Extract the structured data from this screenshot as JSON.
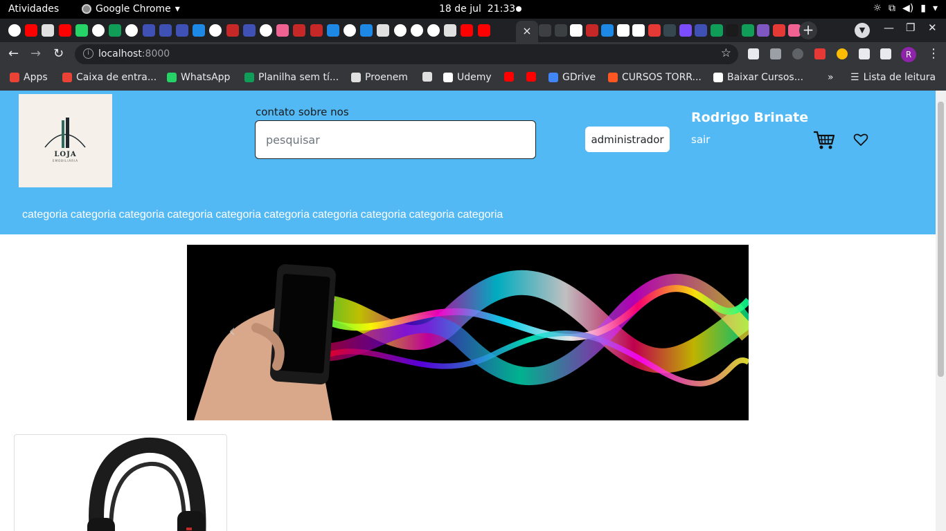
{
  "system": {
    "activities": "Atividades",
    "app_name": "Google Chrome",
    "date": "18 de jul",
    "time": "21:33"
  },
  "browser": {
    "active_tab_close": "×",
    "url_host": "localhost",
    "url_port": ":8000",
    "profile_initial": "R",
    "bookmarks": [
      {
        "label": "Apps",
        "icon": "apps-grid-icon",
        "color": "#ea4335"
      },
      {
        "label": "Caixa de entra...",
        "icon": "gmail-icon",
        "color": "#ea4335"
      },
      {
        "label": "WhatsApp",
        "icon": "whatsapp-icon",
        "color": "#25d366"
      },
      {
        "label": "Planilha sem tí...",
        "icon": "sheets-icon",
        "color": "#0f9d58"
      },
      {
        "label": "Proenem",
        "icon": "proenem-icon",
        "color": "#e0e0e0"
      },
      {
        "label": "",
        "icon": "globe-icon",
        "color": "#e0e0e0"
      },
      {
        "label": "Udemy",
        "icon": "udemy-icon",
        "color": "#ffffff"
      },
      {
        "label": "",
        "icon": "youtube-icon",
        "color": "#ff0000"
      },
      {
        "label": "",
        "icon": "youtube-icon",
        "color": "#ff0000"
      },
      {
        "label": "GDrive",
        "icon": "gdrive-icon",
        "color": "#4285f4"
      },
      {
        "label": "CURSOS TORR...",
        "icon": "blogger-icon",
        "color": "#ff5722"
      },
      {
        "label": "Baixar Cursos...",
        "icon": "drive-icon",
        "color": "#ffffff"
      }
    ],
    "overflow": "»",
    "reading_list": "Lista de leitura"
  },
  "site": {
    "logo_text": "LOJA",
    "logo_subtext": "EMOBILIÁRIA",
    "header_links": "contato sobre nos",
    "search_placeholder": "pesquisar",
    "admin_button": "administrador",
    "user_name": "Rodrigo Brinate",
    "logout": "sair",
    "categories": [
      "categoria",
      "categoria",
      "categoria",
      "categoria",
      "categoria",
      "categoria",
      "categoria",
      "categoria",
      "categoria",
      "categoria"
    ],
    "carousel_prev": "‹",
    "accent_color": "#53b9f5"
  }
}
